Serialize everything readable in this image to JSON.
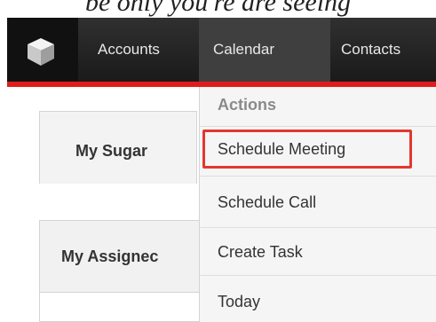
{
  "caption": "be only you're are seeing",
  "nav": {
    "items": [
      {
        "label": "Accounts"
      },
      {
        "label": "Calendar"
      },
      {
        "label": "Contacts"
      }
    ],
    "accent_color": "#e01b1b",
    "logo_icon": "cube-icon"
  },
  "tabs": {
    "my_sugar": "My Sugar"
  },
  "dashlet": {
    "title": "My Assignec"
  },
  "calendar_menu": {
    "heading": "Actions",
    "items": [
      {
        "label": "Schedule Meeting",
        "highlighted": true
      },
      {
        "label": "Schedule Call"
      },
      {
        "label": "Create Task"
      },
      {
        "label": "Today"
      }
    ],
    "highlight_color": "#e2382f"
  }
}
